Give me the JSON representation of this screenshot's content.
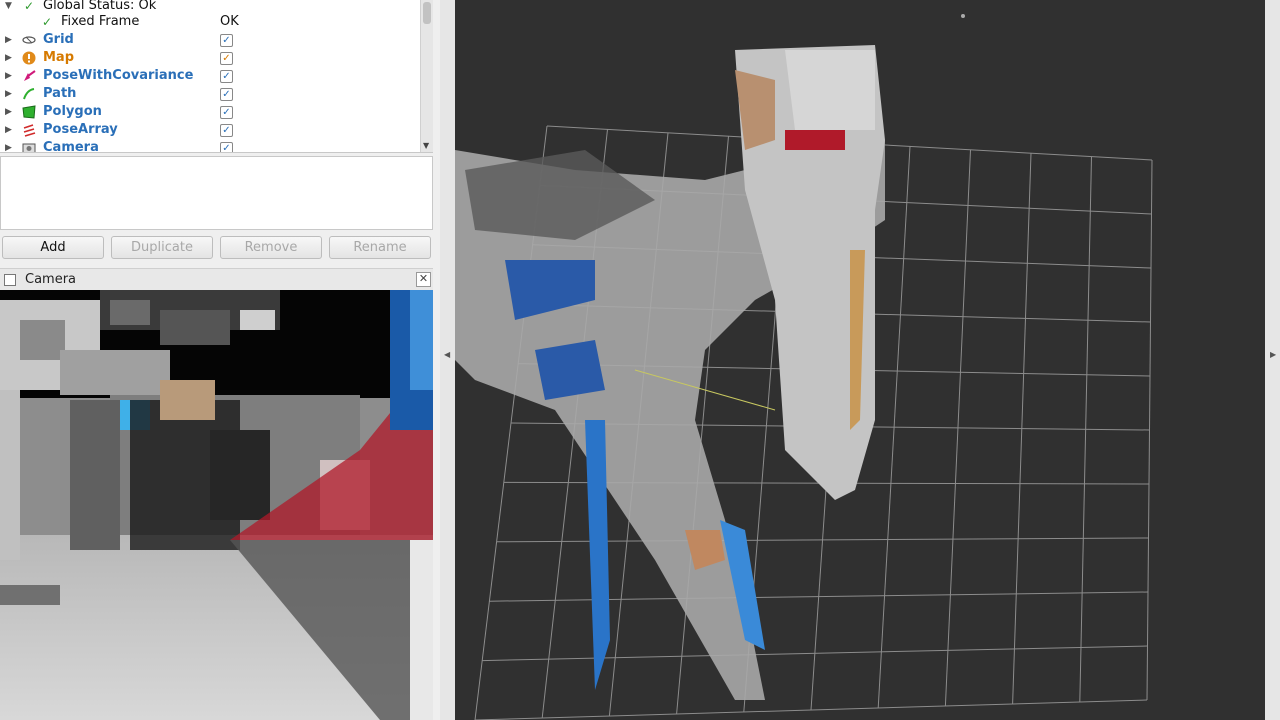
{
  "tree": {
    "global_status": "Global Status: Ok",
    "fixed_frame": "Fixed Frame",
    "fixed_frame_value": "OK",
    "displays": [
      {
        "label": "Grid",
        "icon": "grid-icon",
        "color": "#2a6fb8"
      },
      {
        "label": "Map",
        "icon": "warning-icon",
        "color": "#d67a00"
      },
      {
        "label": "PoseWithCovariance",
        "icon": "pose-covariance-icon",
        "color": "#2a6fb8"
      },
      {
        "label": "Path",
        "icon": "path-icon",
        "color": "#2a6fb8"
      },
      {
        "label": "Polygon",
        "icon": "polygon-icon",
        "color": "#2a6fb8"
      },
      {
        "label": "PoseArray",
        "icon": "pose-array-icon",
        "color": "#2a6fb8"
      },
      {
        "label": "Camera",
        "icon": "camera-icon",
        "color": "#2a6fb8"
      }
    ]
  },
  "buttons": {
    "add": "Add",
    "duplicate": "Duplicate",
    "remove": "Remove",
    "rename": "Rename"
  },
  "camera_panel": {
    "title": "Camera",
    "close_glyph": "✕"
  },
  "colors": {
    "display_label": "#2a6fb8",
    "warning": "#d67a00",
    "background_3d": "#303030",
    "grid_line": "#8c8c8c"
  }
}
